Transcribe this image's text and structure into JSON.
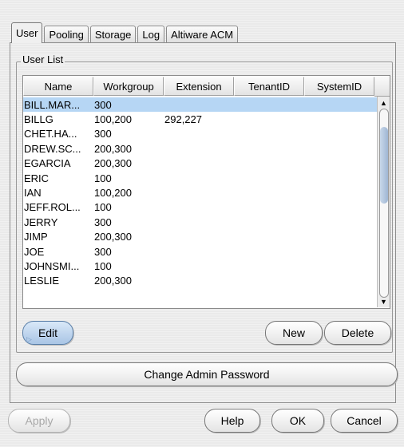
{
  "tabs": [
    "User",
    "Pooling",
    "Storage",
    "Log",
    "Altiware ACM"
  ],
  "user_list": {
    "title": "User List",
    "columns": [
      "Name",
      "Workgroup",
      "Extension",
      "TenantID",
      "SystemID"
    ],
    "rows": [
      {
        "name": "BILL.MAR...",
        "workgroup": "300",
        "extension": "",
        "tenant": "",
        "system": ""
      },
      {
        "name": "BILLG",
        "workgroup": "100,200",
        "extension": "292,227",
        "tenant": "",
        "system": ""
      },
      {
        "name": "CHET.HA...",
        "workgroup": "300",
        "extension": "",
        "tenant": "",
        "system": ""
      },
      {
        "name": "DREW.SC...",
        "workgroup": "200,300",
        "extension": "",
        "tenant": "",
        "system": ""
      },
      {
        "name": "EGARCIA",
        "workgroup": "200,300",
        "extension": "",
        "tenant": "",
        "system": ""
      },
      {
        "name": "ERIC",
        "workgroup": "100",
        "extension": "",
        "tenant": "",
        "system": ""
      },
      {
        "name": "IAN",
        "workgroup": "100,200",
        "extension": "",
        "tenant": "",
        "system": ""
      },
      {
        "name": "JEFF.ROL...",
        "workgroup": "100",
        "extension": "",
        "tenant": "",
        "system": ""
      },
      {
        "name": "JERRY",
        "workgroup": "300",
        "extension": "",
        "tenant": "",
        "system": ""
      },
      {
        "name": "JIMP",
        "workgroup": "200,300",
        "extension": "",
        "tenant": "",
        "system": ""
      },
      {
        "name": "JOE",
        "workgroup": "300",
        "extension": "",
        "tenant": "",
        "system": ""
      },
      {
        "name": "JOHNSMI...",
        "workgroup": "100",
        "extension": "",
        "tenant": "",
        "system": ""
      },
      {
        "name": "LESLIE",
        "workgroup": "200,300",
        "extension": "",
        "tenant": "",
        "system": ""
      }
    ],
    "selected_row": 0
  },
  "buttons": {
    "edit": "Edit",
    "new": "New",
    "delete": "Delete",
    "change_password": "Change Admin Password",
    "apply": "Apply",
    "help": "Help",
    "ok": "OK",
    "cancel": "Cancel"
  },
  "icons": {
    "scroll_up": "triangle-up-icon",
    "scroll_down": "triangle-down-icon",
    "edit_marker": "play-arrow-icon"
  },
  "colors": {
    "selection": "#b6d6f4",
    "scroll_thumb": "#a9c5e5"
  }
}
